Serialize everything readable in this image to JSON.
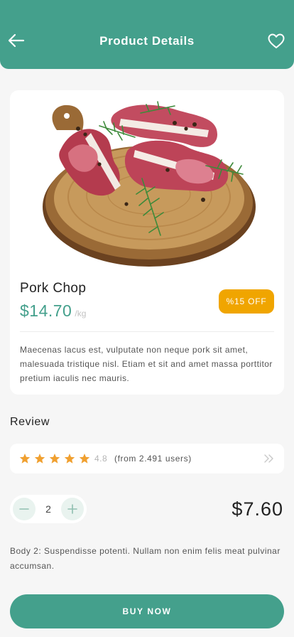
{
  "header": {
    "title": "Product Details",
    "back_icon": "arrow-left-icon",
    "favorite_icon": "heart-icon"
  },
  "product": {
    "name": "Pork Chop",
    "price": "$14.70",
    "unit": "/kg",
    "discount": "%15 OFF",
    "description": "Maecenas lacus est, vulputate non neque pork sit amet, malesuada tristique nisl. Etiam et sit and amet massa porttitor pretium iaculis nec mauris."
  },
  "review": {
    "title": "Review",
    "stars": 5,
    "rating": "4.8",
    "users": "(from 2.491 users)"
  },
  "cart": {
    "quantity": "2",
    "total": "$7.60"
  },
  "body_text": "Body 2: Suspendisse potenti. Nullam non enim felis meat pulvinar accumsan.",
  "buy_button": "BUY NOW",
  "colors": {
    "primary": "#44a08c",
    "accent": "#f0a500",
    "star": "#f0a030",
    "background": "#f6f6f6"
  }
}
